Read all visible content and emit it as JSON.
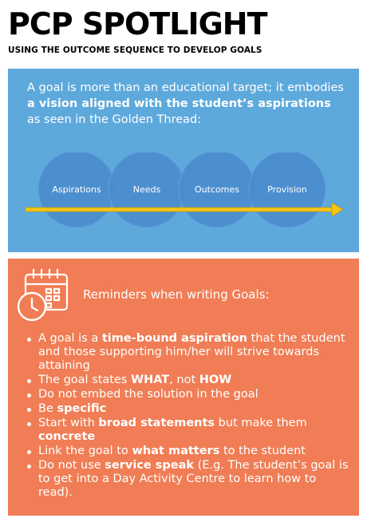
{
  "header": {
    "title": "PCP SPOTLIGHT",
    "subtitle": "USING THE OUTCOME SEQUENCE TO DEVELOP GOALS"
  },
  "intro": {
    "part1": "A goal is more than an educational target; it embodies ",
    "bold": "a vision aligned with the student’s aspirations",
    "part2": " as seen in the Golden Thread:"
  },
  "golden_thread": {
    "circles": [
      "Aspirations",
      "Needs",
      "Outcomes",
      "Provision"
    ]
  },
  "reminders": {
    "title": "Reminders when writing Goals:",
    "items": [
      {
        "t1": "A goal is a ",
        "b1": "time-bound aspiration",
        "t2": " that the student and those supporting him/her will strive towards attaining",
        "b2": "",
        "t3": ""
      },
      {
        "t1": "The goal states ",
        "b1": "WHAT",
        "t2": ", not ",
        "b2": "HOW",
        "t3": ""
      },
      {
        "t1": "Do not embed the solution in the goal",
        "b1": "",
        "t2": "",
        "b2": "",
        "t3": ""
      },
      {
        "t1": "Be ",
        "b1": "specific",
        "t2": "",
        "b2": "",
        "t3": ""
      },
      {
        "t1": "Start with ",
        "b1": "broad statements",
        "t2": " but make them ",
        "b2": "concrete",
        "t3": ""
      },
      {
        "t1": "Link the goal to ",
        "b1": "what matters",
        "t2": " to the student",
        "b2": "",
        "t3": ""
      },
      {
        "t1": "Do not use ",
        "b1": "service speak",
        "t2": " (E.g. The student’s goal is to get into a Day Activity Centre to learn how to read).",
        "b2": "",
        "t3": ""
      }
    ]
  },
  "colors": {
    "blue_panel": "#5ea9dc",
    "circle_fill": "#4a8ccd",
    "orange_panel": "#f07d55",
    "thread": "#f5c518"
  }
}
